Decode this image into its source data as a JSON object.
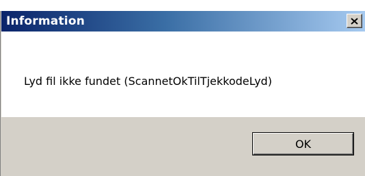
{
  "dialog": {
    "title": "Information",
    "message": "Lyd fil ikke fundet (ScannetOkTilTjekkodeLyd)",
    "ok_label": "OK"
  },
  "colors": {
    "titlebar_start": "#0a246a",
    "titlebar_end": "#a6caf0",
    "button_face": "#d4d0c8"
  },
  "icons": {
    "close": "close-icon"
  }
}
